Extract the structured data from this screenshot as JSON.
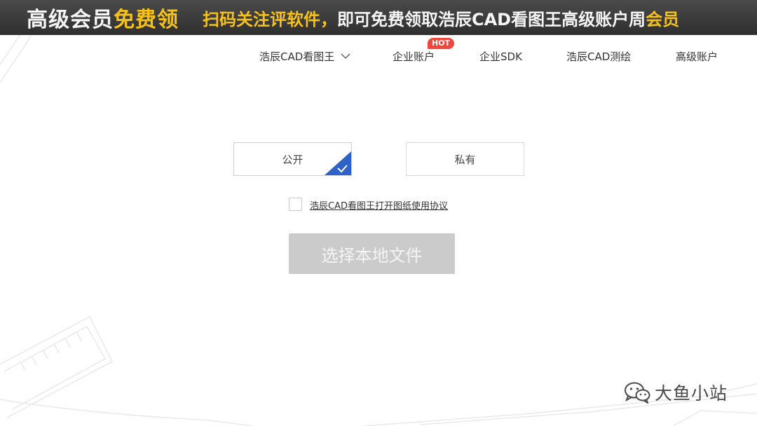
{
  "banner": {
    "title_white": "高级会员",
    "title_yellow": "免费领",
    "subtitle_yellow": "扫码关注评软件，",
    "subtitle_white": "即可免费领取浩辰CAD看图王高级账户周",
    "subtitle_yellow_end": "会员"
  },
  "nav": {
    "items": [
      {
        "label": "浩辰CAD看图王",
        "has_dropdown": true
      },
      {
        "label": "企业账户"
      },
      {
        "label": "企业SDK"
      },
      {
        "label": "浩辰CAD测绘"
      },
      {
        "label": "高级账户"
      }
    ],
    "hot_badge": "HOT"
  },
  "visibility": {
    "public_label": "公开",
    "private_label": "私有",
    "selected": "public"
  },
  "agreement": {
    "link_text": "浩辰CAD看图王打开图纸使用协议",
    "checked": false
  },
  "upload": {
    "button_label": "选择本地文件",
    "disabled": true
  },
  "watermark": {
    "text": "大鱼小站"
  },
  "colors": {
    "banner_yellow": "#f6c21a",
    "accent_blue": "#2f62c8",
    "hot_red": "#f0463c",
    "disabled_button": "#cbcbcb"
  }
}
